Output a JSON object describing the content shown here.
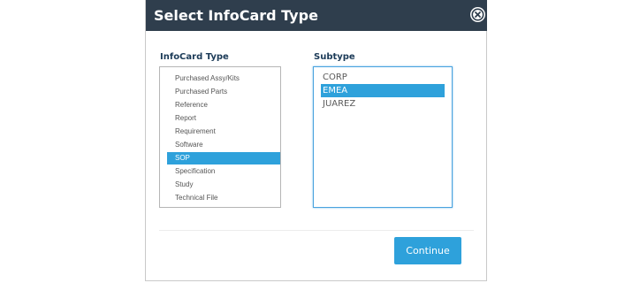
{
  "dialog": {
    "title": "Select InfoCard Type",
    "close_icon": "close-circle-icon"
  },
  "infocard_type": {
    "label": "InfoCard Type",
    "items": [
      "Purchased Assy/Kits",
      "Purchased Parts",
      "Reference",
      "Report",
      "Requirement",
      "Software",
      "SOP",
      "Specification",
      "Study",
      "Technical File"
    ],
    "selected": "SOP",
    "scroll_up_icon": "chevron-up-icon",
    "scroll_down_icon": "chevron-down-icon"
  },
  "subtype": {
    "label": "Subtype",
    "items": [
      "CORP",
      "EMEA",
      "JUAREZ"
    ],
    "selected": "EMEA"
  },
  "footer": {
    "continue_label": "Continue"
  },
  "colors": {
    "header_bg": "#2f3e4d",
    "accent": "#2ea1db",
    "label_text": "#1b3a57"
  }
}
